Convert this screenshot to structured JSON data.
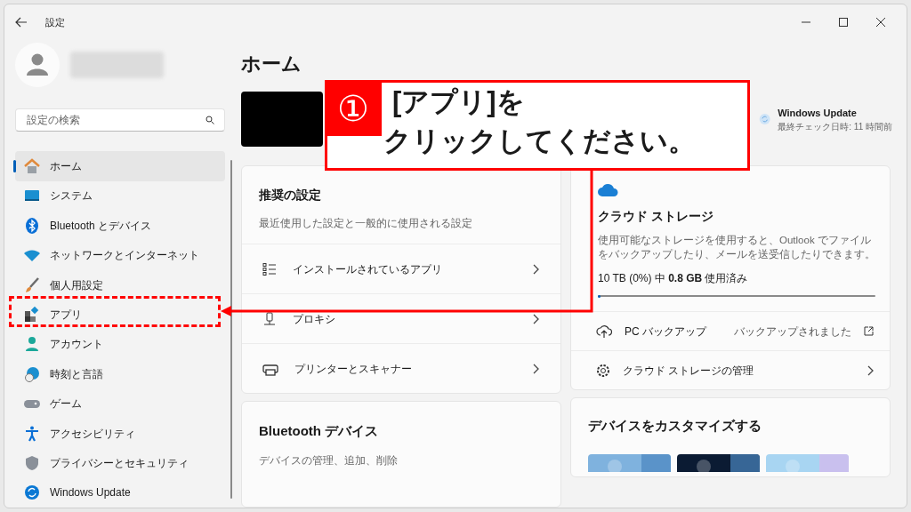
{
  "window": {
    "title": "設定"
  },
  "search": {
    "placeholder": "設定の検索"
  },
  "sidebar": {
    "items": [
      {
        "label": "ホーム",
        "selected": true
      },
      {
        "label": "システム",
        "selected": false
      },
      {
        "label": "Bluetooth とデバイス",
        "selected": false
      },
      {
        "label": "ネットワークとインターネット",
        "selected": false
      },
      {
        "label": "個人用設定",
        "selected": false
      },
      {
        "label": "アプリ",
        "selected": false
      },
      {
        "label": "アカウント",
        "selected": false
      },
      {
        "label": "時刻と言語",
        "selected": false
      },
      {
        "label": "ゲーム",
        "selected": false
      },
      {
        "label": "アクセシビリティ",
        "selected": false
      },
      {
        "label": "プライバシーとセキュリティ",
        "selected": false
      },
      {
        "label": "Windows Update",
        "selected": false
      }
    ]
  },
  "page_title": "ホーム",
  "windows_update": {
    "title": "Windows Update",
    "subtitle": "最終チェック日時: 11 時間前"
  },
  "recommended": {
    "title": "推奨の設定",
    "subtitle": "最近使用した設定と一般的に使用される設定",
    "rows": [
      {
        "label": "インストールされているアプリ"
      },
      {
        "label": "プロキシ"
      },
      {
        "label": "プリンターとスキャナー"
      }
    ]
  },
  "bluetooth": {
    "title": "Bluetooth デバイス",
    "subtitle": "デバイスの管理、追加、削除"
  },
  "cloud": {
    "title": "クラウド ストレージ",
    "description": "使用可能なストレージを使用すると、Outlook でファイルをバックアップしたり、メールを送受信したりできます。",
    "usage": "10 TB (0%) 中 **0.8 GB** 使用済み",
    "level": 0.005,
    "rows": [
      {
        "kind": "link",
        "label": "PC バックアップ",
        "status": "バックアップされました"
      },
      {
        "kind": "nav",
        "label": "クラウド ストレージの管理"
      }
    ]
  },
  "customize": {
    "title": "デバイスをカスタマイズする"
  },
  "callout": {
    "number": "①",
    "lines": [
      "[アプリ]を",
      "クリックしてください。"
    ]
  }
}
